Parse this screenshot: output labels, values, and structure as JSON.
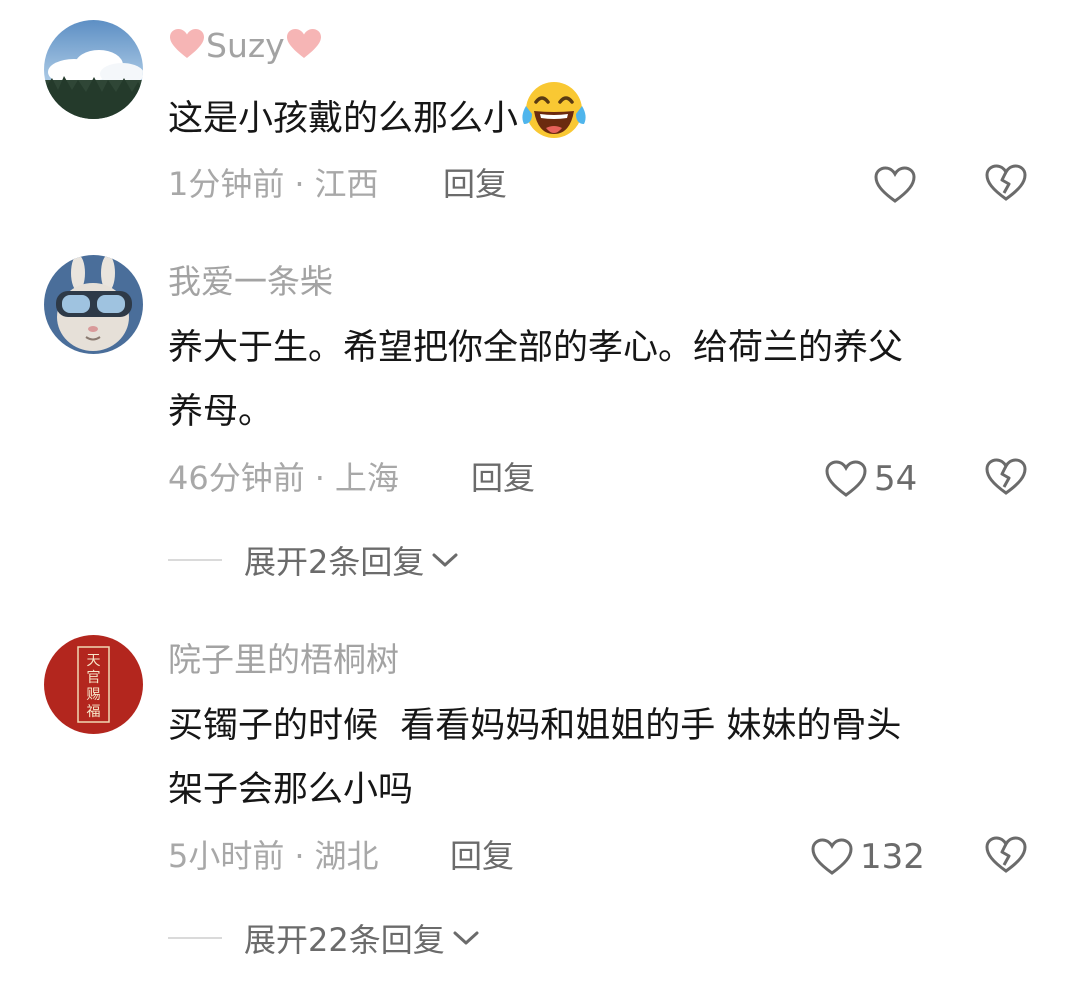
{
  "comments": [
    {
      "username_prefix_icon": "pink-heart-icon",
      "username": "Suzy",
      "username_suffix_icon": "pink-heart-icon",
      "avatar": "sky-clouds-avatar",
      "text_lines": [
        "这是小孩戴的么那么小"
      ],
      "text_emoji": "laugh-crying-emoji",
      "time": "1分钟前",
      "location": "江西",
      "reply_label": "回复",
      "likes": "",
      "like_icon": "heart-outline-icon",
      "dislike_icon": "broken-heart-icon"
    },
    {
      "username": "我爱一条柴",
      "avatar": "bunny-goggles-avatar",
      "text_lines": [
        "养大于生。希望把你全部的孝心。给荷兰的养父",
        "养母。"
      ],
      "time": "46分钟前",
      "location": "上海",
      "reply_label": "回复",
      "likes": "54",
      "like_icon": "heart-outline-icon",
      "dislike_icon": "broken-heart-icon",
      "expand_label": "展开2条回复",
      "expand_icon": "chevron-down-icon"
    },
    {
      "username": "院子里的梧桐树",
      "avatar": "red-seal-avatar",
      "avatar_text": "天官赐福",
      "text_lines": [
        "买镯子的时候  看看妈妈和姐姐的手 妹妹的骨头",
        "架子会那么小吗"
      ],
      "time": "5小时前",
      "location": "湖北",
      "reply_label": "回复",
      "likes": "132",
      "like_icon": "heart-outline-icon",
      "dislike_icon": "broken-heart-icon",
      "expand_label": "展开22条回复",
      "expand_icon": "chevron-down-icon"
    }
  ],
  "meta_separator": "·",
  "colors": {
    "username": "#a3a3a3",
    "text": "#161616",
    "meta": "#a8a8a8",
    "action": "#6b6b6b",
    "pink_heart": "#f6b5b5",
    "seal_red": "#b3261e"
  }
}
